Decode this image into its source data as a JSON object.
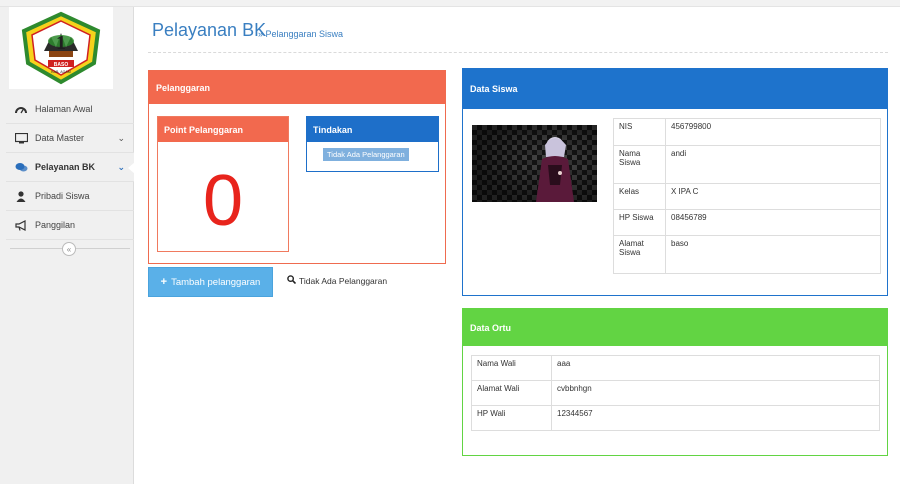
{
  "sidebar": {
    "logo": {
      "banner_text": "BASO",
      "sub_text": "KAB. AGAM",
      "numeral": "1"
    },
    "items": [
      {
        "label": "Halaman Awal",
        "icon": "dashboard-icon"
      },
      {
        "label": "Data Master",
        "icon": "monitor-icon",
        "chevron": "chevron-down-icon"
      },
      {
        "label": "Pelayanan BK",
        "icon": "chat-icon",
        "chevron": "chevron-down-icon"
      },
      {
        "label": "Pribadi Siswa",
        "icon": "user-icon"
      },
      {
        "label": "Panggilan",
        "icon": "megaphone-icon"
      }
    ],
    "collapse_icon": "chevron-left-circle-icon"
  },
  "header": {
    "title": "Pelayanan BK",
    "breadcrumb": "» Pelanggaran Siswa"
  },
  "pelanggaran": {
    "title": "Pelanggaran",
    "point_title": "Point Pelanggaran",
    "point_value": "0",
    "tindakan_title": "Tindakan",
    "tindakan_badge": "Tidak Ada Pelanggaran",
    "add_button": "Tambah pelanggaran",
    "no_violation_link": "Tidak Ada Pelanggaran"
  },
  "data_siswa": {
    "title": "Data Siswa",
    "rows": [
      {
        "label": "NIS",
        "value": "456799800"
      },
      {
        "label": "Nama Siswa",
        "value": "andi"
      },
      {
        "label": "Kelas",
        "value": "X IPA C"
      },
      {
        "label": "HP Siswa",
        "value": "08456789"
      },
      {
        "label": "Alamat Siswa",
        "value": "baso"
      }
    ]
  },
  "data_ortu": {
    "title": "Data Ortu",
    "rows": [
      {
        "label": "Nama Wali",
        "value": "aaa"
      },
      {
        "label": "Alamat Wali",
        "value": "cvbbnhgn"
      },
      {
        "label": "HP Wali",
        "value": "12344567"
      }
    ]
  },
  "colors": {
    "primary_blue": "#1e73cc",
    "orange": "#f2694e",
    "green": "#62d443",
    "red_value": "#e8241c",
    "button_blue": "#5ab0e8"
  }
}
